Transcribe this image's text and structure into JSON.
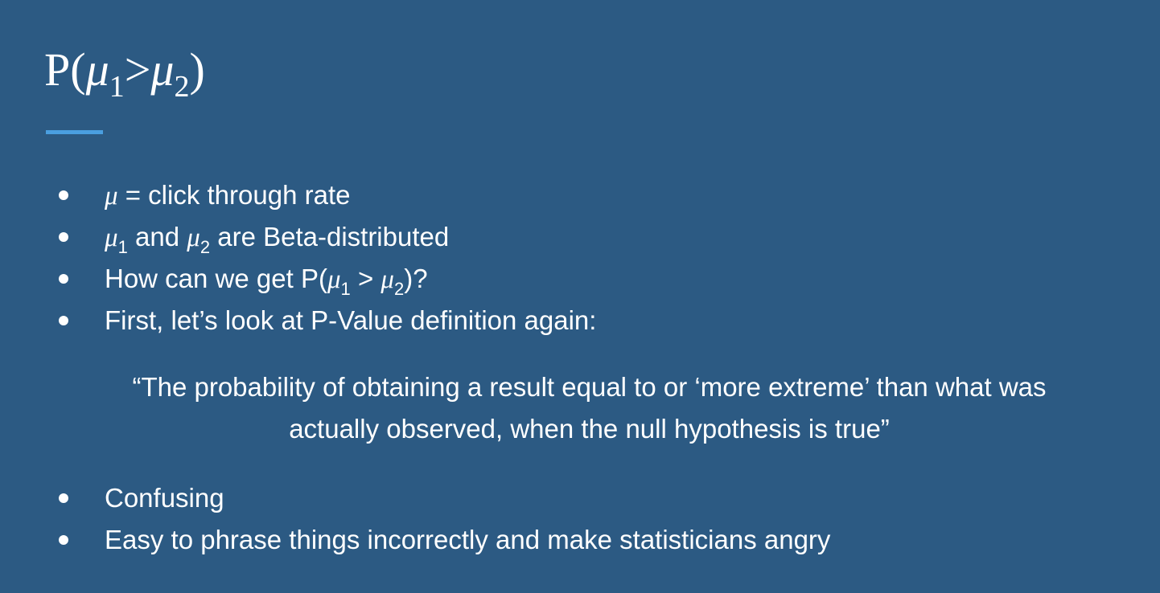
{
  "title": {
    "prefix": "P(",
    "mu1": "μ",
    "sub1": "1",
    "gt": ">",
    "mu2": "μ",
    "sub2": "2",
    "suffix": ")"
  },
  "colors": {
    "background": "#2c5a83",
    "text": "#ffffff",
    "accent": "#4a9fe0"
  },
  "bullets_top": [
    {
      "mu": "μ",
      "text": " = click through rate"
    },
    {
      "mu1": "μ",
      "sub1": "1",
      "mid": " and ",
      "mu2": "μ",
      "sub2": "2",
      "text": " are Beta-distributed"
    },
    {
      "prefix": "How can we get P(",
      "mu1": "μ",
      "sub1": "1",
      "mid": " > ",
      "mu2": "μ",
      "sub2": "2",
      "suffix": ")?"
    },
    {
      "text": "First, let’s look at P-Value definition again:"
    }
  ],
  "quote": {
    "line1": "“The probability of obtaining a result equal to or ‘more extreme’ than what was",
    "line2": "actually observed, when the null hypothesis is true”"
  },
  "bullets_bottom": [
    {
      "text": "Confusing"
    },
    {
      "text": "Easy to phrase things incorrectly and make statisticians angry"
    }
  ]
}
